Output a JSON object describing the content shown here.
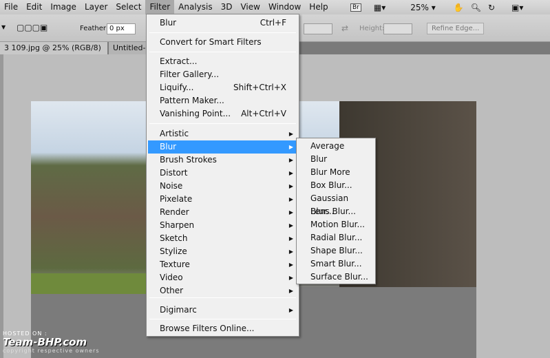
{
  "menubar": {
    "items": [
      "File",
      "Edit",
      "Image",
      "Layer",
      "Select",
      "Filter",
      "Analysis",
      "3D",
      "View",
      "Window",
      "Help"
    ],
    "bridge": "Br",
    "zoom": "25%"
  },
  "options": {
    "feather_label": "Feather:",
    "feather_value": "0 px",
    "height_label": "Height:",
    "refine_edge": "Refine Edge..."
  },
  "tabs": [
    "3 109.jpg @ 25% (RGB/8)",
    "Untitled-"
  ],
  "tab_close": "×",
  "filter_menu": {
    "last_filter": {
      "label": "Blur",
      "shortcut": "Ctrl+F"
    },
    "convert": "Convert for Smart Filters",
    "group2": [
      {
        "label": "Extract..."
      },
      {
        "label": "Filter Gallery..."
      },
      {
        "label": "Liquify...",
        "shortcut": "Shift+Ctrl+X"
      },
      {
        "label": "Pattern Maker..."
      },
      {
        "label": "Vanishing Point...",
        "shortcut": "Alt+Ctrl+V"
      }
    ],
    "submenus": [
      "Artistic",
      "Blur",
      "Brush Strokes",
      "Distort",
      "Noise",
      "Pixelate",
      "Render",
      "Sharpen",
      "Sketch",
      "Stylize",
      "Texture",
      "Video",
      "Other"
    ],
    "digimarc": "Digimarc",
    "browse": "Browse Filters Online..."
  },
  "blur_submenu": [
    "Average",
    "Blur",
    "Blur More",
    "Box Blur...",
    "Gaussian Blur...",
    "Lens Blur...",
    "Motion Blur...",
    "Radial Blur...",
    "Shape Blur...",
    "Smart Blur...",
    "Surface Blur..."
  ],
  "watermark": {
    "hosted": "HOSTED ON :",
    "brand": "Team-BHP.com",
    "copyright": "copyright respective owners"
  },
  "colors": {
    "highlight": "#3399ff"
  }
}
